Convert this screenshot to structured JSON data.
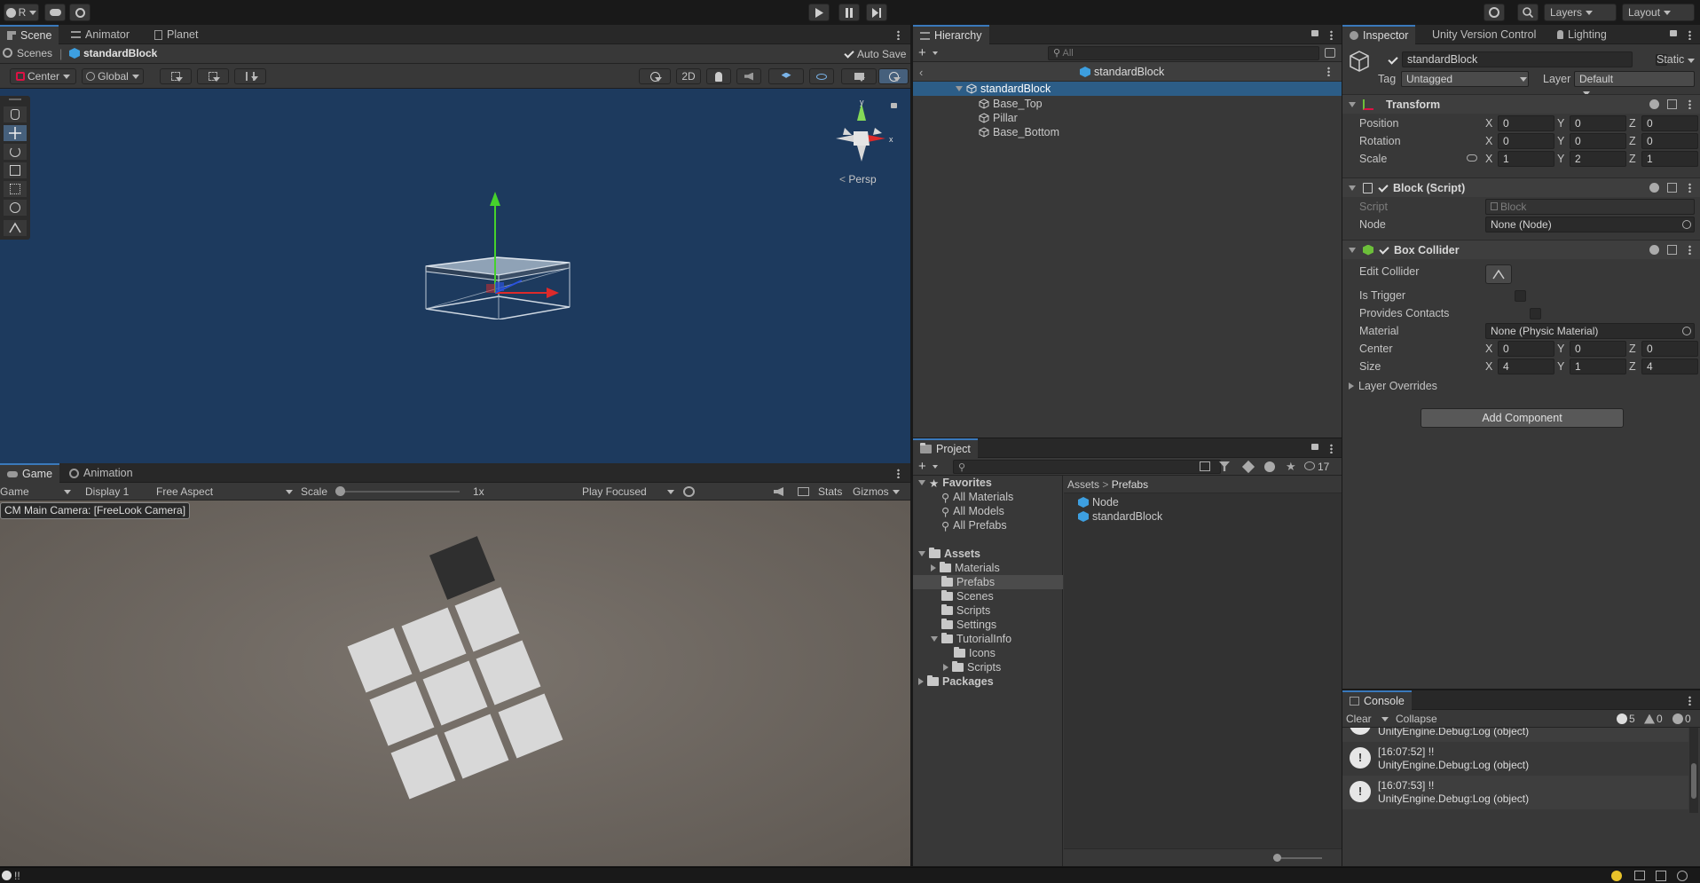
{
  "toolbar": {
    "account_label": "R",
    "layers_label": "Layers",
    "layout_label": "Layout"
  },
  "scene_tabs": [
    {
      "label": "Scene"
    },
    {
      "label": "Animator"
    },
    {
      "label": "Planet"
    }
  ],
  "scene": {
    "breadcrumb_root": "Scenes",
    "breadcrumb_item": "standardBlock",
    "auto_save": "Auto Save",
    "pivot": "Center",
    "space": "Global",
    "mode_2d": "2D",
    "persp": "Persp"
  },
  "game_tabs": [
    {
      "label": "Game"
    },
    {
      "label": "Animation"
    }
  ],
  "game": {
    "view": "Game",
    "display": "Display 1",
    "aspect": "Free Aspect",
    "scale_label": "Scale",
    "scale_value": "1x",
    "play_mode": "Play Focused",
    "stats": "Stats",
    "gizmos": "Gizmos",
    "camera_label": "CM Main Camera: [FreeLook Camera]"
  },
  "hierarchy": {
    "tab": "Hierarchy",
    "search_placeholder": "All",
    "prefab_title": "standardBlock",
    "items": [
      {
        "label": "standardBlock"
      },
      {
        "label": "Base_Top"
      },
      {
        "label": "Pillar"
      },
      {
        "label": "Base_Bottom"
      }
    ]
  },
  "project": {
    "tab": "Project",
    "hidden_count": "17",
    "favorites": "Favorites",
    "favorite_items": [
      "All Materials",
      "All Models",
      "All Prefabs"
    ],
    "assets": "Assets",
    "asset_folders": [
      "Materials",
      "Prefabs",
      "Scenes",
      "Scripts",
      "Settings",
      "TutorialInfo"
    ],
    "tutorial_children": [
      "Icons",
      "Scripts"
    ],
    "packages": "Packages",
    "path_root": "Assets",
    "path_leaf": "Prefabs",
    "files": [
      "Node",
      "standardBlock"
    ]
  },
  "inspector": {
    "tabs": [
      {
        "label": "Inspector"
      },
      {
        "label": "Unity Version Control"
      },
      {
        "label": "Lighting"
      }
    ],
    "object_name": "standardBlock",
    "static_label": "Static",
    "tag_label": "Tag",
    "tag_value": "Untagged",
    "layer_label": "Layer",
    "layer_value": "Default",
    "transform": {
      "title": "Transform",
      "position_label": "Position",
      "rotation_label": "Rotation",
      "scale_label": "Scale",
      "position": [
        "0",
        "0",
        "0"
      ],
      "rotation": [
        "0",
        "0",
        "0"
      ],
      "scale": [
        "1",
        "2",
        "1"
      ]
    },
    "block": {
      "title": "Block (Script)",
      "script_label": "Script",
      "script_value": "Block",
      "node_label": "Node",
      "node_value": "None (Node)"
    },
    "collider": {
      "title": "Box Collider",
      "edit_label": "Edit Collider",
      "trigger_label": "Is Trigger",
      "contacts_label": "Provides Contacts",
      "material_label": "Material",
      "material_value": "None (Physic Material)",
      "center_label": "Center",
      "size_label": "Size",
      "center": [
        "0",
        "0",
        "0"
      ],
      "size": [
        "4",
        "1",
        "4"
      ],
      "layer_overrides": "Layer Overrides"
    },
    "add_component": "Add Component",
    "axis": [
      "X",
      "Y",
      "Z"
    ]
  },
  "console": {
    "tab": "Console",
    "clear": "Clear",
    "collapse": "Collapse",
    "log_count": "5",
    "warn_count": "0",
    "error_count": "0",
    "entries": [
      {
        "line1": "",
        "line2": "UnityEngine.Debug:Log (object)"
      },
      {
        "line1": "[16:07:52] !!",
        "line2": "UnityEngine.Debug:Log (object)"
      },
      {
        "line1": "[16:07:53] !!",
        "line2": "UnityEngine.Debug:Log (object)"
      }
    ]
  },
  "status": {
    "message": "!!"
  },
  "colors": {
    "scene_bg": "#1d3a5e",
    "game_bg": "#6c6660",
    "selection": "#2c5d87",
    "accent": "#3a79bb"
  }
}
